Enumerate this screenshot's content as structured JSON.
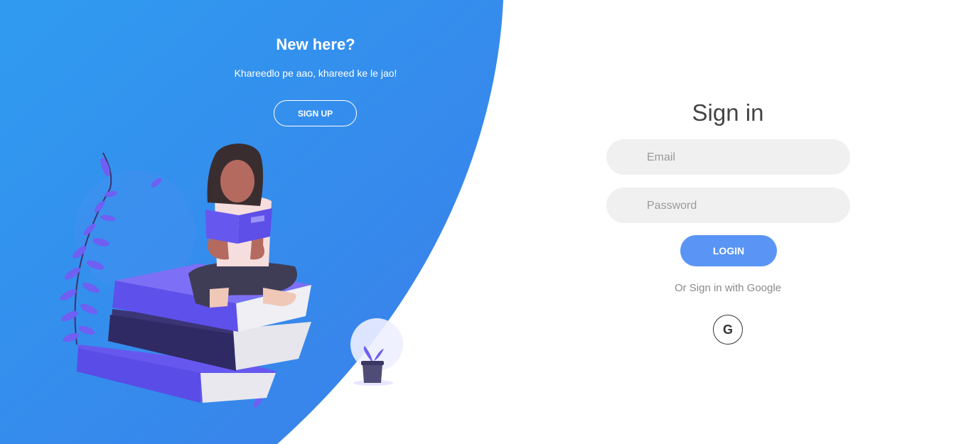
{
  "left_panel": {
    "title": "New here?",
    "subtitle": "Khareedlo pe aao, khareed ke le jao!",
    "signup_label": "SIGN UP"
  },
  "sign_in": {
    "title": "Sign in",
    "email_placeholder": "Email",
    "password_placeholder": "Password",
    "login_label": "LOGIN",
    "social_text": "Or Sign in with Google",
    "google_glyph": "G"
  },
  "colors": {
    "gradient_start": "#2d9cef",
    "gradient_end": "#3a7fe9",
    "login_button": "#5a95f5",
    "input_background": "#f0f0f0",
    "title_text": "#444444"
  },
  "icons": {
    "google": "google-icon"
  }
}
